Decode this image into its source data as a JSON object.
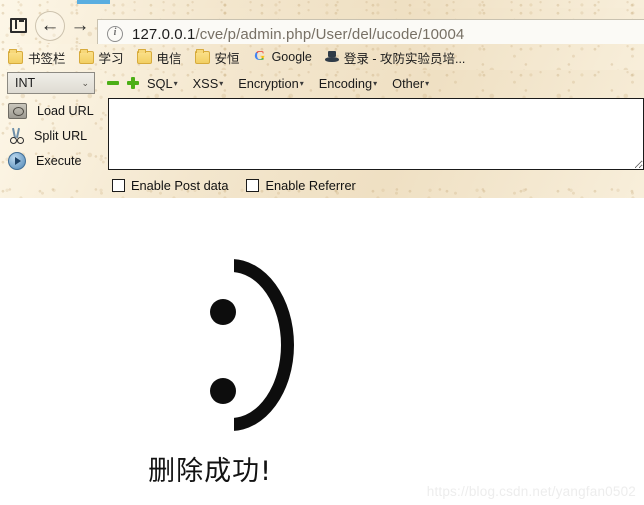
{
  "browser": {
    "tab_sliver": "active-tab",
    "panel_icon": "sidebar-panel-icon",
    "back_label": "←",
    "forward_label": "→",
    "info_icon_label": "i",
    "url_host": "127.0.0.1",
    "url_path": "/cve/p/admin.php/User/del/ucode/10004"
  },
  "bookmarks": {
    "items": [
      {
        "label": "书签栏",
        "icon": "folder-icon"
      },
      {
        "label": "学习",
        "icon": "folder-icon"
      },
      {
        "label": "电信",
        "icon": "folder-icon"
      },
      {
        "label": "安恒",
        "icon": "folder-icon"
      },
      {
        "label": "Google",
        "icon": "google-g-icon"
      },
      {
        "label": "登录 - 攻防实验员培...",
        "icon": "hat-favicon"
      }
    ]
  },
  "hackbar": {
    "type_select": {
      "value": "INT",
      "chevron": "⌄"
    },
    "minus_label": "remove-tab",
    "plus_label": "add-tab",
    "menus": [
      {
        "label": "SQL",
        "caret": "▾"
      },
      {
        "label": "XSS",
        "caret": "▾"
      },
      {
        "label": "Encryption",
        "caret": "▾"
      },
      {
        "label": "Encoding",
        "caret": "▾"
      },
      {
        "label": "Other",
        "caret": "▾"
      }
    ],
    "buttons": [
      {
        "label": "Load URL",
        "icon": "load-url-icon"
      },
      {
        "label": "Split URL",
        "icon": "scissors-icon"
      },
      {
        "label": "Execute",
        "icon": "play-icon"
      }
    ],
    "textarea_value": "",
    "checkboxes": [
      {
        "label": "Enable Post data",
        "checked": false
      },
      {
        "label": "Enable Referrer",
        "checked": false
      }
    ]
  },
  "page": {
    "face": ":)",
    "message": "删除成功!",
    "watermark": "https://blog.csdn.net/yangfan0502"
  },
  "colors": {
    "chrome_bg": "#f3e6cd",
    "accent_green": "#4caf16",
    "tab_blue": "#5aaee0",
    "text_dark": "#1b1b1b",
    "url_gray": "#777065",
    "watermark_gray": "#ededed"
  }
}
